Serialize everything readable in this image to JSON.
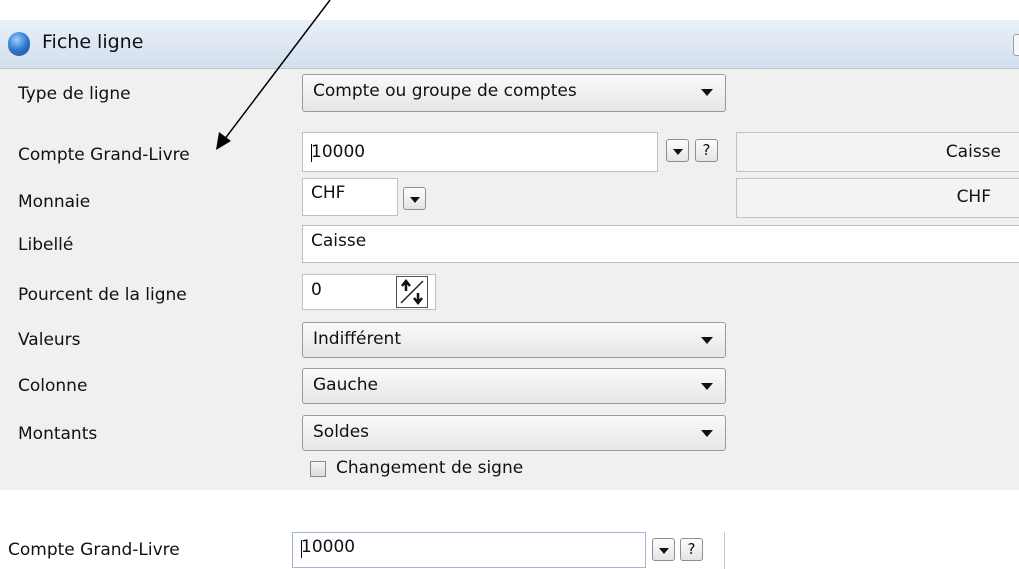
{
  "window": {
    "title": "Fiche ligne"
  },
  "form": {
    "type_ligne": {
      "label": "Type de ligne",
      "value": "Compte ou groupe de comptes"
    },
    "compte": {
      "label": "Compte Grand-Livre",
      "value": "10000",
      "help": "?",
      "description": "Caisse"
    },
    "monnaie": {
      "label": "Monnaie",
      "value": "CHF",
      "description": "CHF"
    },
    "libelle": {
      "label": "Libellé",
      "value": "Caisse"
    },
    "pourcent": {
      "label": "Pourcent de la ligne",
      "value": "0"
    },
    "valeurs": {
      "label": "Valeurs",
      "value": "Indifférent"
    },
    "colonne": {
      "label": "Colonne",
      "value": "Gauche"
    },
    "montants": {
      "label": "Montants",
      "value": "Soldes"
    },
    "changement": {
      "label": "Changement de signe",
      "checked": false
    }
  },
  "zoom": {
    "compte": {
      "label": "Compte Grand-Livre",
      "value": "10000",
      "help": "?"
    }
  },
  "icons": {
    "app": "app-globe-icon",
    "dropdown": "chevron-down-icon",
    "spinner": "spinner-icon",
    "annotation": "annotation-arrow"
  },
  "colors": {
    "titlebar": "#d9e4f1",
    "window_bg": "#f0f0f0"
  }
}
